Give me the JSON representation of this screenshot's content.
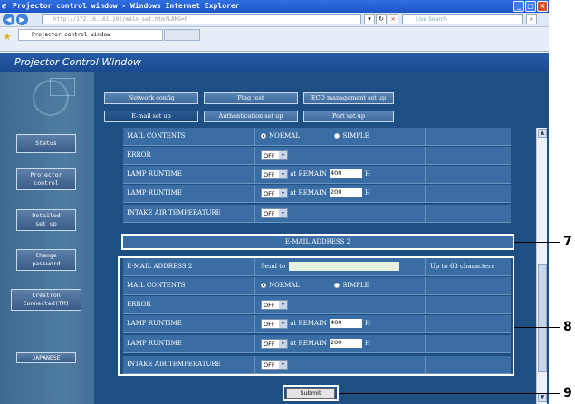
{
  "window": {
    "title": "Projector control window - Windows Internet Explorer"
  },
  "browser": {
    "url": "http://172.16.161.192/main_set.htm?LANG=0",
    "search_placeholder": "Live Search",
    "tab_label": "Projector control window"
  },
  "app_title": "Projector Control Window",
  "sidebar": {
    "items": [
      {
        "label": "Status"
      },
      {
        "label": "Projector\ncontrol"
      },
      {
        "label": "Detailed\nset up"
      },
      {
        "label": "Change\npassword"
      },
      {
        "label": "Crestron\nConnected(TM)"
      },
      {
        "label": "JAPANESE"
      }
    ]
  },
  "tabs_row1": [
    {
      "label": "Network config"
    },
    {
      "label": "Ping test"
    },
    {
      "label": "ECO management set up"
    }
  ],
  "tabs_row2": [
    {
      "label": "E-mail set up",
      "active": true
    },
    {
      "label": "Authentication set up"
    },
    {
      "label": "Port set up"
    }
  ],
  "section1": {
    "rows": [
      {
        "label": "MAIL CONTENTS",
        "normal": "NORMAL",
        "simple": "SIMPLE"
      },
      {
        "label": "ERROR",
        "select": "OFF"
      },
      {
        "label": "LAMP  RUNTIME",
        "select": "OFF",
        "prefix": "at REMAIN",
        "value": "400",
        "unit": "H"
      },
      {
        "label": "LAMP  RUNTIME",
        "select": "OFF",
        "prefix": "at REMAIN",
        "value": "200",
        "unit": "H"
      },
      {
        "label": "INTAKE AIR TEMPERATURE",
        "select": "OFF"
      }
    ]
  },
  "section2": {
    "header": "E-MAIL ADDRESS 2",
    "address": {
      "label": "E-MAIL ADDRESS 2",
      "send_to": "Send to",
      "hint": "Up to 63 characters"
    },
    "rows": [
      {
        "label": "MAIL CONTENTS",
        "normal": "NORMAL",
        "simple": "SIMPLE"
      },
      {
        "label": "ERROR",
        "select": "OFF"
      },
      {
        "label": "LAMP  RUNTIME",
        "select": "OFF",
        "prefix": "at REMAIN",
        "value": "400",
        "unit": "H"
      },
      {
        "label": "LAMP  RUNTIME",
        "select": "OFF",
        "prefix": "at REMAIN",
        "value": "200",
        "unit": "H"
      },
      {
        "label": "INTAKE AIR TEMPERATURE",
        "select": "OFF"
      }
    ]
  },
  "submit_label": "Submit",
  "callouts": {
    "c7": "7",
    "c8": "8",
    "c9": "9"
  }
}
